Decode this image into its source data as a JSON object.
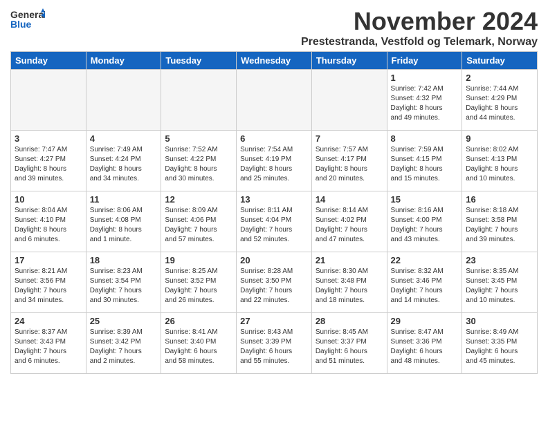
{
  "header": {
    "logo_general": "General",
    "logo_blue": "Blue",
    "month_title": "November 2024",
    "location": "Prestestranda, Vestfold og Telemark, Norway"
  },
  "days_of_week": [
    "Sunday",
    "Monday",
    "Tuesday",
    "Wednesday",
    "Thursday",
    "Friday",
    "Saturday"
  ],
  "weeks": [
    [
      {
        "day": "",
        "info": "",
        "empty": true
      },
      {
        "day": "",
        "info": "",
        "empty": true
      },
      {
        "day": "",
        "info": "",
        "empty": true
      },
      {
        "day": "",
        "info": "",
        "empty": true
      },
      {
        "day": "",
        "info": "",
        "empty": true
      },
      {
        "day": "1",
        "info": "Sunrise: 7:42 AM\nSunset: 4:32 PM\nDaylight: 8 hours\nand 49 minutes."
      },
      {
        "day": "2",
        "info": "Sunrise: 7:44 AM\nSunset: 4:29 PM\nDaylight: 8 hours\nand 44 minutes."
      }
    ],
    [
      {
        "day": "3",
        "info": "Sunrise: 7:47 AM\nSunset: 4:27 PM\nDaylight: 8 hours\nand 39 minutes."
      },
      {
        "day": "4",
        "info": "Sunrise: 7:49 AM\nSunset: 4:24 PM\nDaylight: 8 hours\nand 34 minutes."
      },
      {
        "day": "5",
        "info": "Sunrise: 7:52 AM\nSunset: 4:22 PM\nDaylight: 8 hours\nand 30 minutes."
      },
      {
        "day": "6",
        "info": "Sunrise: 7:54 AM\nSunset: 4:19 PM\nDaylight: 8 hours\nand 25 minutes."
      },
      {
        "day": "7",
        "info": "Sunrise: 7:57 AM\nSunset: 4:17 PM\nDaylight: 8 hours\nand 20 minutes."
      },
      {
        "day": "8",
        "info": "Sunrise: 7:59 AM\nSunset: 4:15 PM\nDaylight: 8 hours\nand 15 minutes."
      },
      {
        "day": "9",
        "info": "Sunrise: 8:02 AM\nSunset: 4:13 PM\nDaylight: 8 hours\nand 10 minutes."
      }
    ],
    [
      {
        "day": "10",
        "info": "Sunrise: 8:04 AM\nSunset: 4:10 PM\nDaylight: 8 hours\nand 6 minutes."
      },
      {
        "day": "11",
        "info": "Sunrise: 8:06 AM\nSunset: 4:08 PM\nDaylight: 8 hours\nand 1 minute."
      },
      {
        "day": "12",
        "info": "Sunrise: 8:09 AM\nSunset: 4:06 PM\nDaylight: 7 hours\nand 57 minutes."
      },
      {
        "day": "13",
        "info": "Sunrise: 8:11 AM\nSunset: 4:04 PM\nDaylight: 7 hours\nand 52 minutes."
      },
      {
        "day": "14",
        "info": "Sunrise: 8:14 AM\nSunset: 4:02 PM\nDaylight: 7 hours\nand 47 minutes."
      },
      {
        "day": "15",
        "info": "Sunrise: 8:16 AM\nSunset: 4:00 PM\nDaylight: 7 hours\nand 43 minutes."
      },
      {
        "day": "16",
        "info": "Sunrise: 8:18 AM\nSunset: 3:58 PM\nDaylight: 7 hours\nand 39 minutes."
      }
    ],
    [
      {
        "day": "17",
        "info": "Sunrise: 8:21 AM\nSunset: 3:56 PM\nDaylight: 7 hours\nand 34 minutes."
      },
      {
        "day": "18",
        "info": "Sunrise: 8:23 AM\nSunset: 3:54 PM\nDaylight: 7 hours\nand 30 minutes."
      },
      {
        "day": "19",
        "info": "Sunrise: 8:25 AM\nSunset: 3:52 PM\nDaylight: 7 hours\nand 26 minutes."
      },
      {
        "day": "20",
        "info": "Sunrise: 8:28 AM\nSunset: 3:50 PM\nDaylight: 7 hours\nand 22 minutes."
      },
      {
        "day": "21",
        "info": "Sunrise: 8:30 AM\nSunset: 3:48 PM\nDaylight: 7 hours\nand 18 minutes."
      },
      {
        "day": "22",
        "info": "Sunrise: 8:32 AM\nSunset: 3:46 PM\nDaylight: 7 hours\nand 14 minutes."
      },
      {
        "day": "23",
        "info": "Sunrise: 8:35 AM\nSunset: 3:45 PM\nDaylight: 7 hours\nand 10 minutes."
      }
    ],
    [
      {
        "day": "24",
        "info": "Sunrise: 8:37 AM\nSunset: 3:43 PM\nDaylight: 7 hours\nand 6 minutes."
      },
      {
        "day": "25",
        "info": "Sunrise: 8:39 AM\nSunset: 3:42 PM\nDaylight: 7 hours\nand 2 minutes."
      },
      {
        "day": "26",
        "info": "Sunrise: 8:41 AM\nSunset: 3:40 PM\nDaylight: 6 hours\nand 58 minutes."
      },
      {
        "day": "27",
        "info": "Sunrise: 8:43 AM\nSunset: 3:39 PM\nDaylight: 6 hours\nand 55 minutes."
      },
      {
        "day": "28",
        "info": "Sunrise: 8:45 AM\nSunset: 3:37 PM\nDaylight: 6 hours\nand 51 minutes."
      },
      {
        "day": "29",
        "info": "Sunrise: 8:47 AM\nSunset: 3:36 PM\nDaylight: 6 hours\nand 48 minutes."
      },
      {
        "day": "30",
        "info": "Sunrise: 8:49 AM\nSunset: 3:35 PM\nDaylight: 6 hours\nand 45 minutes."
      }
    ]
  ]
}
